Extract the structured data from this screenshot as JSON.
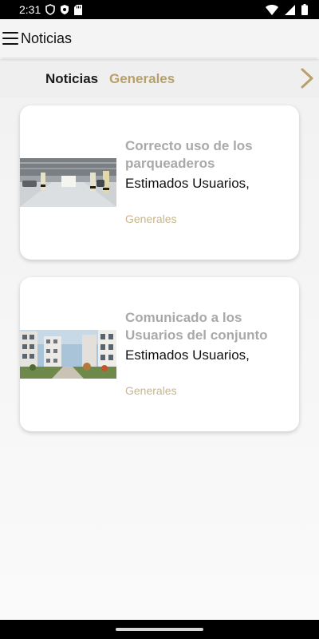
{
  "status_bar": {
    "time": "2:31",
    "icons": [
      "vpn-shield-icon",
      "privacy-shield-icon",
      "sd-card-icon",
      "wifi-icon",
      "signal-icon",
      "battery-icon"
    ]
  },
  "app_bar": {
    "title": "Noticias",
    "menu_icon": "hamburger-menu-icon"
  },
  "tabs": [
    {
      "label": "Noticias",
      "selected": false
    },
    {
      "label": "Generales",
      "selected": true
    }
  ],
  "tabs_arrow_icon": "chevron-right-icon",
  "colors": {
    "accent": "#b8a06a",
    "category": "#c7b68c",
    "title_muted": "#a9a9a9"
  },
  "news": [
    {
      "title": "Correcto uso de los parqueaderos",
      "excerpt": "Estimados Usuarios,",
      "category": "Generales",
      "image": "parking-garage-photo"
    },
    {
      "title": "Comunicado a los Usuarios del conjunto",
      "excerpt": "Estimados Usuarios,",
      "category": "Generales",
      "image": "apartment-buildings-photo"
    }
  ]
}
